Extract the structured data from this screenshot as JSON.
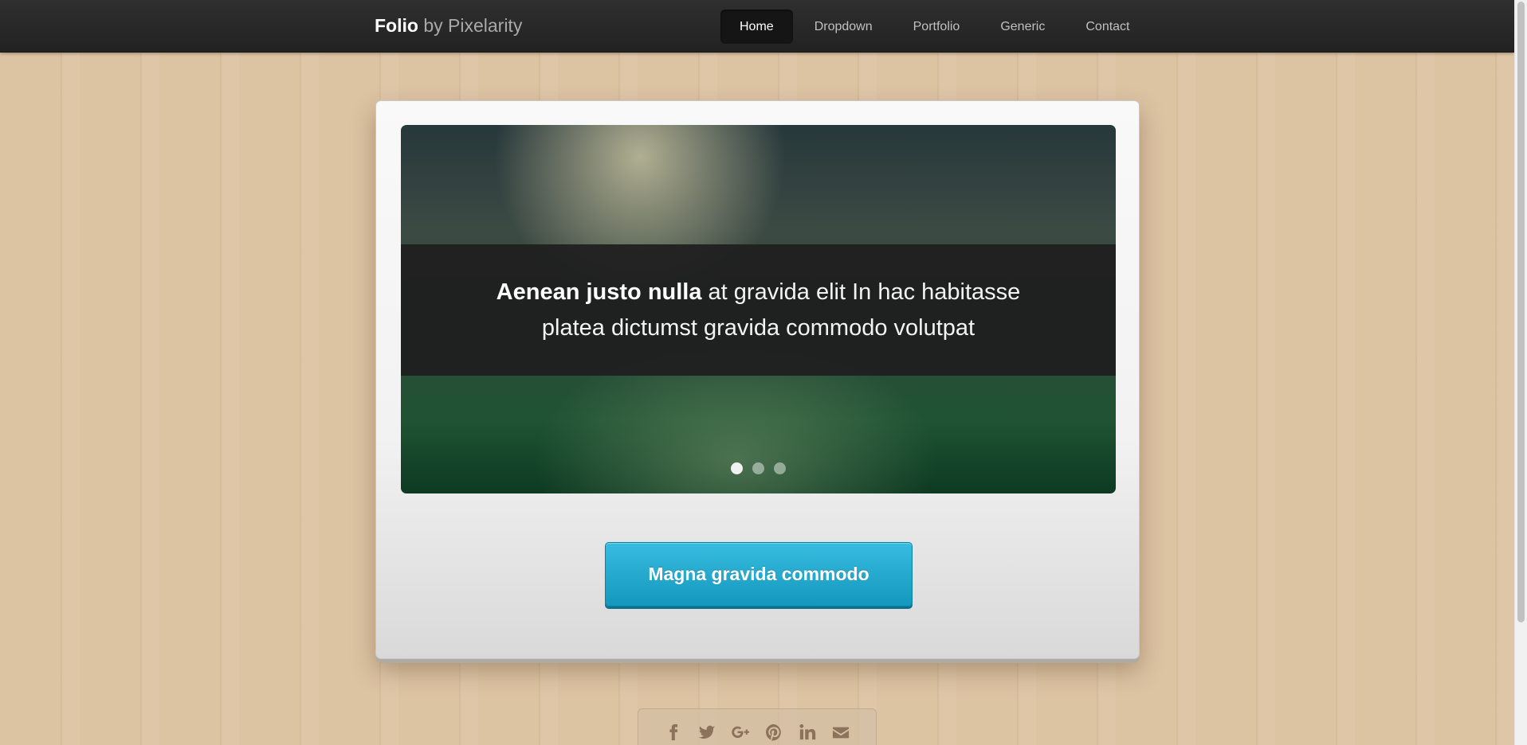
{
  "header": {
    "brand": "Folio",
    "by": "by Pixelarity",
    "nav": [
      {
        "label": "Home",
        "active": true
      },
      {
        "label": "Dropdown",
        "active": false
      },
      {
        "label": "Portfolio",
        "active": false
      },
      {
        "label": "Generic",
        "active": false
      },
      {
        "label": "Contact",
        "active": false
      }
    ]
  },
  "slider": {
    "caption_strong": "Aenean justo nulla",
    "caption_rest": " at gravida elit In hac habitasse platea dictumst gravida commodo volutpat",
    "slide_count": 3,
    "active_slide": 1
  },
  "cta": {
    "label": "Magna gravida commodo"
  },
  "social": {
    "icons": [
      "facebook-icon",
      "twitter-icon",
      "google-plus-icon",
      "pinterest-icon",
      "linkedin-icon",
      "envelope-icon"
    ]
  },
  "colors": {
    "header_bg": "#262626",
    "button": "#22abd1",
    "background": "#dcc3a2"
  }
}
